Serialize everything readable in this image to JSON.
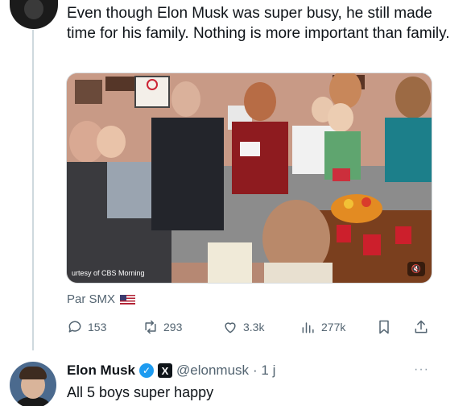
{
  "post": {
    "text": "Even though Elon Musk was super busy, he still made time for his family. Nothing is more important than family.",
    "media_caption": "urtesy of CBS Morning",
    "source": "Par SMX"
  },
  "actions": {
    "replies": "153",
    "reposts": "293",
    "likes": "3.3k",
    "views": "277k"
  },
  "reply": {
    "name": "Elon Musk",
    "handle": "@elonmusk",
    "time": "· 1 j",
    "text": "All 5 boys super happy",
    "more": "···"
  },
  "colors": {
    "accent": "#1d9bf0",
    "muted": "#536471"
  }
}
